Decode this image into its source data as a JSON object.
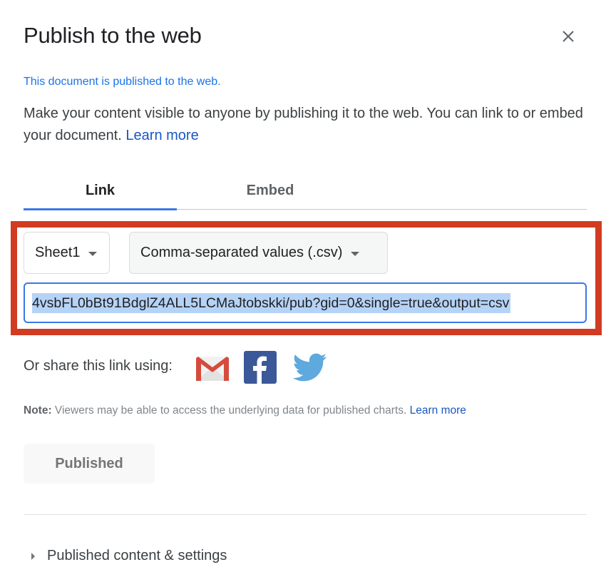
{
  "dialog": {
    "title": "Publish to the web",
    "close_icon": "close-icon",
    "status": "This document is published to the web.",
    "description": "Make your content visible to anyone by publishing it to the web. You can link to or embed your document.",
    "learn_more": "Learn more"
  },
  "tabs": [
    {
      "label": "Link",
      "active": true
    },
    {
      "label": "Embed",
      "active": false
    }
  ],
  "selects": {
    "sheet": "Sheet1",
    "format": "Comma-separated values (.csv)"
  },
  "url_field": {
    "value": "4vsbFL0bBt91BdglZ4ALL5LCMaJtobskki/pub?gid=0&single=true&output=csv",
    "selected": true
  },
  "share": {
    "label": "Or share this link using:",
    "services": [
      {
        "name": "Gmail",
        "icon": "gmail-icon"
      },
      {
        "name": "Facebook",
        "icon": "facebook-icon"
      },
      {
        "name": "Twitter",
        "icon": "twitter-icon"
      }
    ]
  },
  "note": {
    "prefix": "Note:",
    "text": " Viewers may be able to access the underlying data for published charts. ",
    "link": "Learn more"
  },
  "published_button": "Published",
  "expander": {
    "label": "Published content & settings",
    "expanded": false
  },
  "colors": {
    "accent_blue": "#1a73e8",
    "highlight_red": "#d13b22",
    "selection": "#b5d3f6"
  }
}
